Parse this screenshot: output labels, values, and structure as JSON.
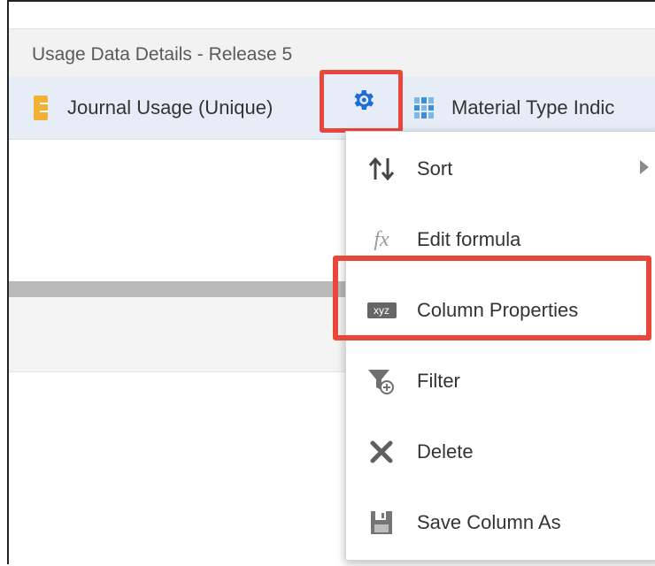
{
  "report": {
    "title": "Usage Data Details - Release 5"
  },
  "columns": [
    {
      "label": "Journal Usage (Unique)",
      "icon": "ruler-icon"
    },
    {
      "label": "Material Type Indic",
      "icon": "grid-icon"
    }
  ],
  "gear_button": {
    "icon": "gear-icon",
    "color": "#1e6ed6"
  },
  "context_menu": {
    "items": [
      {
        "label": "Sort",
        "icon": "sort-arrows-icon",
        "has_submenu": true
      },
      {
        "label": "Edit formula",
        "icon": "fx-icon",
        "glyph": "fx"
      },
      {
        "label": "Column Properties",
        "icon": "xyz-icon",
        "glyph": "xyz",
        "highlighted": true
      },
      {
        "label": "Filter",
        "icon": "filter-icon"
      },
      {
        "label": "Delete",
        "icon": "delete-x-icon"
      },
      {
        "label": "Save Column As",
        "icon": "save-icon"
      }
    ]
  },
  "highlight_color": "#e8473a"
}
